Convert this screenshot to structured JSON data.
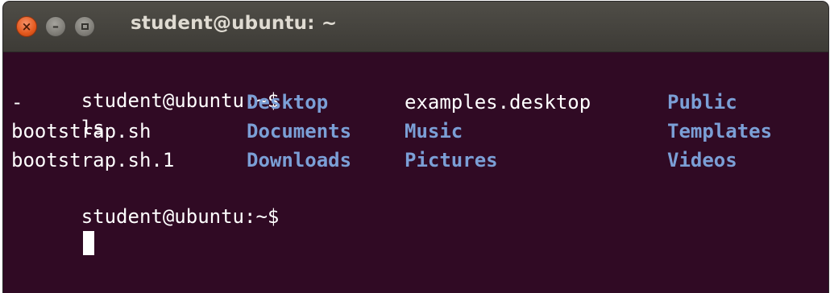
{
  "window": {
    "title": "student@ubuntu: ~",
    "controls": {
      "close_glyph": "×",
      "minimize_glyph": "–"
    }
  },
  "terminal": {
    "colors": {
      "background": "#300a24",
      "text": "#ffffff",
      "directory": "#7b9fd6"
    },
    "command_line": {
      "prompt": "student@ubuntu:~$",
      "command": "ls"
    },
    "listing": {
      "rows": [
        [
          {
            "name": "-",
            "type": "file"
          },
          {
            "name": "Desktop",
            "type": "directory"
          },
          {
            "name": "examples.desktop",
            "type": "file"
          },
          {
            "name": "Public",
            "type": "directory"
          }
        ],
        [
          {
            "name": "bootstrap.sh",
            "type": "file"
          },
          {
            "name": "Documents",
            "type": "directory"
          },
          {
            "name": "Music",
            "type": "directory"
          },
          {
            "name": "Templates",
            "type": "directory"
          }
        ],
        [
          {
            "name": "bootstrap.sh.1",
            "type": "file"
          },
          {
            "name": "Downloads",
            "type": "directory"
          },
          {
            "name": "Pictures",
            "type": "directory"
          },
          {
            "name": "Videos",
            "type": "directory"
          }
        ]
      ]
    },
    "current_prompt": {
      "prompt": "student@ubuntu:~$",
      "input": ""
    }
  }
}
